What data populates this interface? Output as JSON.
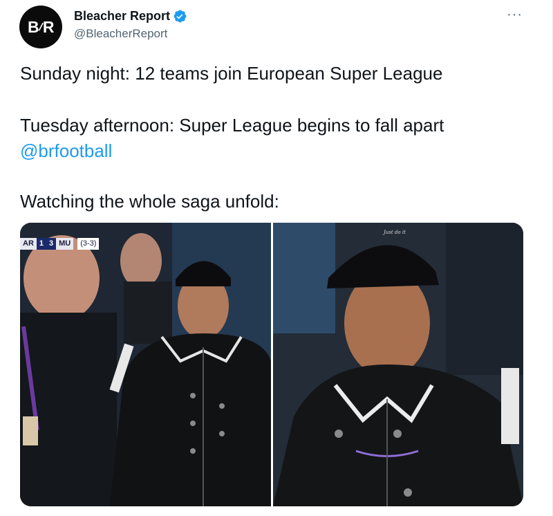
{
  "tweet": {
    "display_name": "Bleacher Report",
    "handle": "@BleacherReport",
    "avatar_text": "B/R",
    "verified": true,
    "more_glyph": "···",
    "lines": [
      "Sunday night: 12 teams join European Super League",
      "Tuesday afternoon: Super League begins to fall apart",
      "Watching the whole saga unfold:"
    ],
    "mention": "@brfootball"
  },
  "media": {
    "scorebug": {
      "team_a": "AR",
      "score_a": "1",
      "score_b": "3",
      "team_b": "MU",
      "aggregate": "(3-3)"
    },
    "cap_text": "Just do it",
    "icons": [
      "verified-badge-icon",
      "more-icon"
    ],
    "colors": {
      "link": "#1d9bf0",
      "text": "#0f1419",
      "secondary": "#536471"
    }
  }
}
